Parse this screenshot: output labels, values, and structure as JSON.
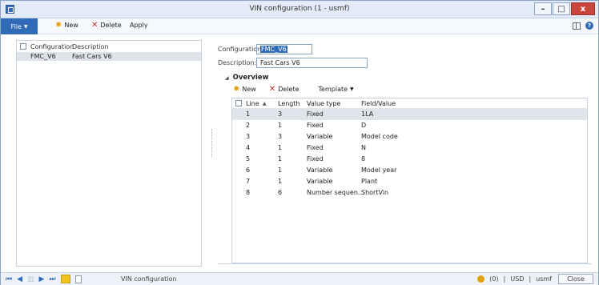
{
  "window": {
    "title": "VIN configuration (1 - usmf)"
  },
  "ribbon": {
    "file_label": "File",
    "new_label": "New",
    "delete_label": "Delete",
    "apply_label": "Apply"
  },
  "list": {
    "headers": {
      "configuration": "Configuration",
      "description": "Description"
    },
    "rows": [
      {
        "configuration": "FMC_V6",
        "description": "Fast Cars V6"
      }
    ]
  },
  "details": {
    "configuration_label": "Configuration:",
    "configuration_value": "FMC_V6",
    "description_label": "Description:",
    "description_value": "Fast Cars V6"
  },
  "overview": {
    "title": "Overview",
    "new_label": "New",
    "delete_label": "Delete",
    "template_label": "Template",
    "headers": {
      "line": "Line",
      "length": "Length",
      "value_type": "Value type",
      "field_value": "Field/Value"
    },
    "rows": [
      {
        "line": "1",
        "length": "3",
        "value_type": "Fixed",
        "field_value": "1LA"
      },
      {
        "line": "2",
        "length": "1",
        "value_type": "Fixed",
        "field_value": "D"
      },
      {
        "line": "3",
        "length": "3",
        "value_type": "Variable",
        "field_value": "Model code"
      },
      {
        "line": "4",
        "length": "1",
        "value_type": "Fixed",
        "field_value": "N"
      },
      {
        "line": "5",
        "length": "1",
        "value_type": "Fixed",
        "field_value": "8"
      },
      {
        "line": "6",
        "length": "1",
        "value_type": "Variable",
        "field_value": "Model year"
      },
      {
        "line": "7",
        "length": "1",
        "value_type": "Variable",
        "field_value": "Plant"
      },
      {
        "line": "8",
        "length": "6",
        "value_type": "Number sequen...",
        "field_value": "ShortVin"
      }
    ]
  },
  "status": {
    "form_name": "VIN configuration",
    "notifications": "(0)",
    "currency": "USD",
    "company": "usmf",
    "close_label": "Close"
  },
  "colors": {
    "accent": "#2f6bb7",
    "selection": "#dfe3ea"
  }
}
